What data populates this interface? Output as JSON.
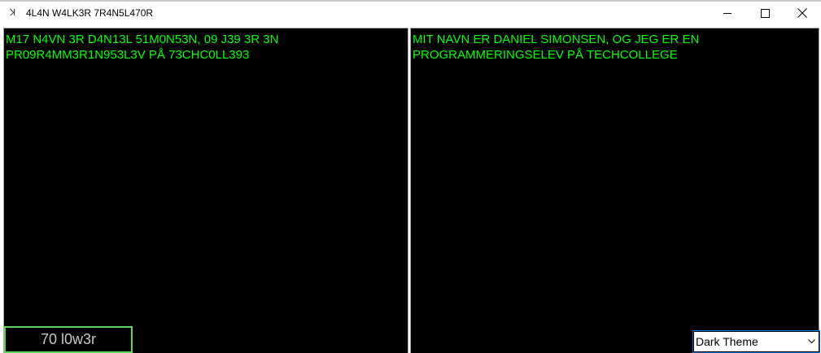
{
  "window": {
    "title": "4L4N W4LK3R 7R4N5L470R",
    "icon": "app-icon",
    "controls": {
      "minimize": "minimize-icon",
      "maximize": "maximize-icon",
      "close": "close-icon"
    }
  },
  "left_panel": {
    "text": "M17 N4VN 3R D4N13L 51M0N53N, 09 J39 3R 3N PR09R4MM3R1N953L3V PÅ 73CHC0LL393"
  },
  "right_panel": {
    "text": "MIT NAVN ER DANIEL SIMONSEN, OG JEG ER EN PROGRAMMERINGSELEV PÅ TECHCOLLEGE"
  },
  "translate_button": {
    "label": "70 l0w3r"
  },
  "theme_select": {
    "selected": "Dark Theme",
    "icon": "chevron-down-icon"
  },
  "colors": {
    "text_green": "#00ff00",
    "panel_bg": "#000000",
    "button_border": "#5cd65c",
    "select_focus": "#0078d7"
  }
}
